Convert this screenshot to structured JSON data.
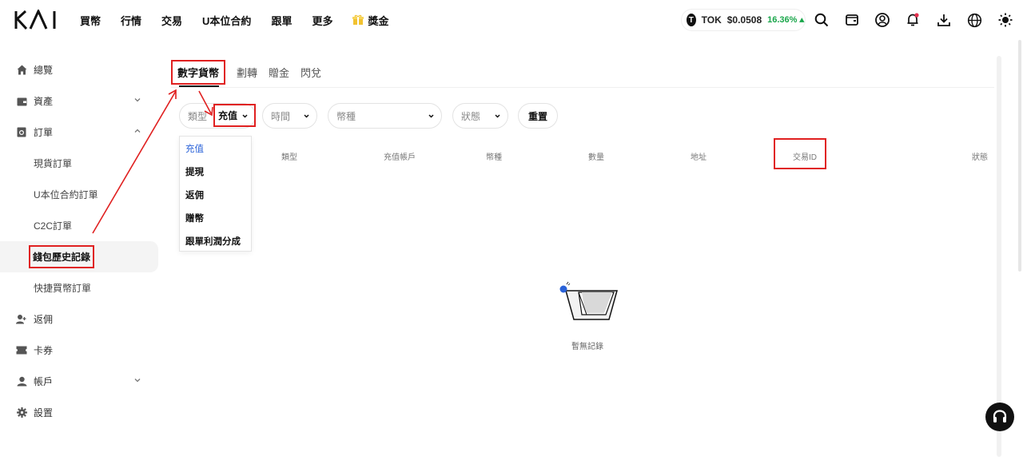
{
  "header": {
    "logo_text": "KAI",
    "nav": [
      "買幣",
      "行情",
      "交易",
      "U本位合約",
      "跟單",
      "更多"
    ],
    "bonus_label": "獎金",
    "ticker": {
      "symbol": "TOK",
      "price": "$0.0508",
      "change": "16.36%",
      "icon_letter": "T"
    }
  },
  "sidebar": {
    "overview": "總覽",
    "assets": "資產",
    "orders": "訂單",
    "order_subitems": [
      "現貨訂單",
      "U本位合約訂單",
      "C2C訂單",
      "錢包歷史記錄",
      "快捷買幣訂單"
    ],
    "rebate": "返佣",
    "coupons": "卡券",
    "account": "帳戶",
    "settings": "設置"
  },
  "tabs": [
    "數字貨幣",
    "劃轉",
    "贈金",
    "閃兌"
  ],
  "filters": {
    "type_label": "類型",
    "type_value": "充值",
    "time_placeholder": "時間",
    "currency_placeholder": "幣種",
    "status_placeholder": "狀態",
    "reset_label": "重置"
  },
  "type_options": [
    "充值",
    "提現",
    "返佣",
    "贈幣",
    "跟單利潤分成"
  ],
  "table": {
    "columns": [
      "類型",
      "充值帳戶",
      "幣種",
      "數量",
      "地址",
      "交易ID",
      "狀態"
    ]
  },
  "empty_state": {
    "text": "暫無記錄"
  },
  "colors": {
    "accent_blue": "#2a62d8",
    "highlight_red": "#e02020",
    "up_green": "#19a64a"
  }
}
